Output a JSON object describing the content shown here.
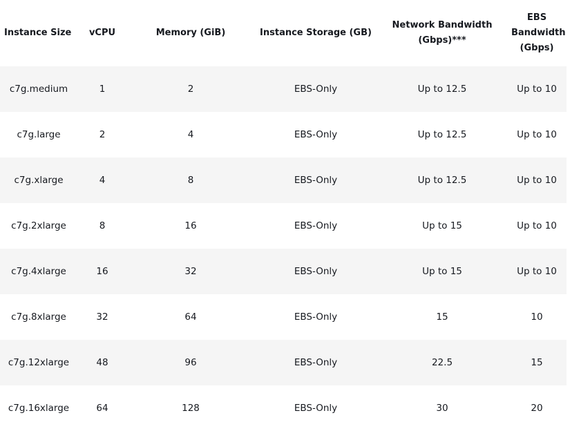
{
  "table": {
    "headers": {
      "instance_size": "Instance Size",
      "vcpu": "vCPU",
      "memory": "Memory (GiB)",
      "storage": "Instance Storage (GB)",
      "network": "Network Bandwidth (Gbps)***",
      "ebs": "EBS Bandwidth (Gbps)"
    },
    "rows": [
      {
        "size": "c7g.medium",
        "vcpu": "1",
        "memory": "2",
        "storage": "EBS-Only",
        "network": "Up to 12.5",
        "ebs": "Up to 10"
      },
      {
        "size": "c7g.large",
        "vcpu": "2",
        "memory": "4",
        "storage": "EBS-Only",
        "network": "Up to 12.5",
        "ebs": "Up to 10"
      },
      {
        "size": "c7g.xlarge",
        "vcpu": "4",
        "memory": "8",
        "storage": "EBS-Only",
        "network": "Up to 12.5",
        "ebs": "Up to 10"
      },
      {
        "size": "c7g.2xlarge",
        "vcpu": "8",
        "memory": "16",
        "storage": "EBS-Only",
        "network": "Up to 15",
        "ebs": "Up to 10"
      },
      {
        "size": "c7g.4xlarge",
        "vcpu": "16",
        "memory": "32",
        "storage": "EBS-Only",
        "network": "Up to 15",
        "ebs": "Up to 10"
      },
      {
        "size": "c7g.8xlarge",
        "vcpu": "32",
        "memory": "64",
        "storage": "EBS-Only",
        "network": "15",
        "ebs": "10"
      },
      {
        "size": "c7g.12xlarge",
        "vcpu": "48",
        "memory": "96",
        "storage": "EBS-Only",
        "network": "22.5",
        "ebs": "15"
      },
      {
        "size": "c7g.16xlarge",
        "vcpu": "64",
        "memory": "128",
        "storage": "EBS-Only",
        "network": "30",
        "ebs": "20"
      }
    ]
  }
}
